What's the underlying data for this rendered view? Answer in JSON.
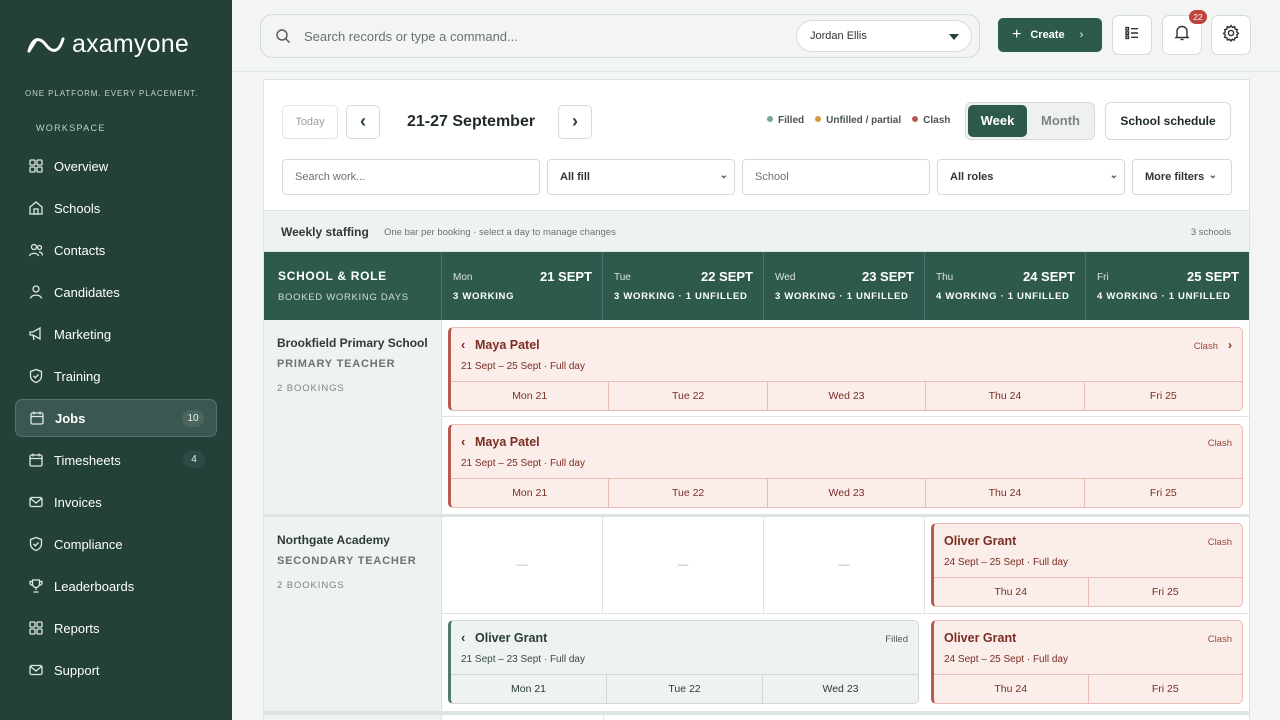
{
  "brand": {
    "name": "axamyone",
    "tagline": "ONE PLATFORM. EVERY PLACEMENT."
  },
  "sidebar": {
    "section_label": "WORKSPACE",
    "items": [
      {
        "label": "Overview",
        "icon": "grid-icon"
      },
      {
        "label": "Schools",
        "icon": "school-icon"
      },
      {
        "label": "Contacts",
        "icon": "contacts-icon"
      },
      {
        "label": "Candidates",
        "icon": "user-icon"
      },
      {
        "label": "Marketing",
        "icon": "megaphone-icon"
      },
      {
        "label": "Training",
        "icon": "shield-check-icon"
      },
      {
        "label": "Jobs",
        "icon": "calendar-icon",
        "badge": "10",
        "active": true
      },
      {
        "label": "Timesheets",
        "icon": "calendar-icon",
        "badge": "4"
      },
      {
        "label": "Invoices",
        "icon": "mail-icon"
      },
      {
        "label": "Compliance",
        "icon": "shield-check-icon"
      },
      {
        "label": "Leaderboards",
        "icon": "trophy-icon"
      },
      {
        "label": "Reports",
        "icon": "grid-icon"
      },
      {
        "label": "Support",
        "icon": "mail-icon"
      }
    ]
  },
  "topbar": {
    "search_placeholder": "Search records or type a command...",
    "user": "Jordan Ellis",
    "create_label": "Create",
    "notifications_count": "22"
  },
  "toolbar": {
    "today": "Today",
    "prev": "‹",
    "next": "›",
    "range": "21-27 September",
    "legend": {
      "filled": "Filled",
      "unfilled": "Unfilled / partial",
      "clash": "Clash"
    },
    "view_week": "Week",
    "view_month": "Month",
    "school_schedule": "School schedule"
  },
  "filters": {
    "search_work": "Search work...",
    "fill": "All fill",
    "school": "School",
    "roles": "All roles",
    "more": "More filters"
  },
  "weekly": {
    "title": "Weekly staffing",
    "subtitle": "One bar per booking · select a day to manage changes",
    "count": "3 schools"
  },
  "grid": {
    "head_title": "SCHOOL & ROLE",
    "head_sub": "BOOKED WORKING DAYS",
    "days": [
      {
        "day": "Mon",
        "date": "21 SEPT",
        "status": "3 WORKING"
      },
      {
        "day": "Tue",
        "date": "22 SEPT",
        "status": "3 WORKING · 1 UNFILLED"
      },
      {
        "day": "Wed",
        "date": "23 SEPT",
        "status": "3 WORKING · 1 UNFILLED"
      },
      {
        "day": "Thu",
        "date": "24 SEPT",
        "status": "4 WORKING · 1 UNFILLED"
      },
      {
        "day": "Fri",
        "date": "25 SEPT",
        "status": "4 WORKING · 1 UNFILLED"
      }
    ]
  },
  "groups": [
    {
      "school": "Brookfield Primary School",
      "role": "PRIMARY TEACHER",
      "bookings_label": "2 BOOKINGS",
      "bookings": [
        {
          "name": "Maya Patel",
          "dates": "21 Sept – 25 Sept · Full day",
          "status": "Clash",
          "days": [
            "Mon 21",
            "Tue 22",
            "Wed 23",
            "Thu 24",
            "Fri 25"
          ]
        },
        {
          "name": "Maya Patel",
          "dates": "21 Sept – 25 Sept · Full day",
          "status": "Clash",
          "days": [
            "Mon 21",
            "Tue 22",
            "Wed 23",
            "Thu 24",
            "Fri 25"
          ]
        }
      ]
    },
    {
      "school": "Northgate Academy",
      "role": "SECONDARY TEACHER",
      "bookings_label": "2 BOOKINGS",
      "empty_mark": "—",
      "bookings": [
        {
          "name": "Oliver Grant",
          "dates": "24 Sept – 25 Sept · Full day",
          "status": "Clash",
          "days": [
            "Thu 24",
            "Fri 25"
          ]
        },
        {
          "name": "Oliver Grant",
          "dates": "21 Sept – 23 Sept · Full day",
          "status": "Filled",
          "days": [
            "Mon 21",
            "Tue 22",
            "Wed 23"
          ]
        },
        {
          "name": "Oliver Grant",
          "dates": "24 Sept – 25 Sept · Full day",
          "status": "Clash",
          "days": [
            "Thu 24",
            "Fri 25"
          ]
        }
      ]
    }
  ],
  "colors": {
    "sidebar": "#234039",
    "accent": "#2e5a4e",
    "filled": "#7aa898",
    "unfilled": "#d59a3e",
    "clash": "#b95a4e"
  }
}
